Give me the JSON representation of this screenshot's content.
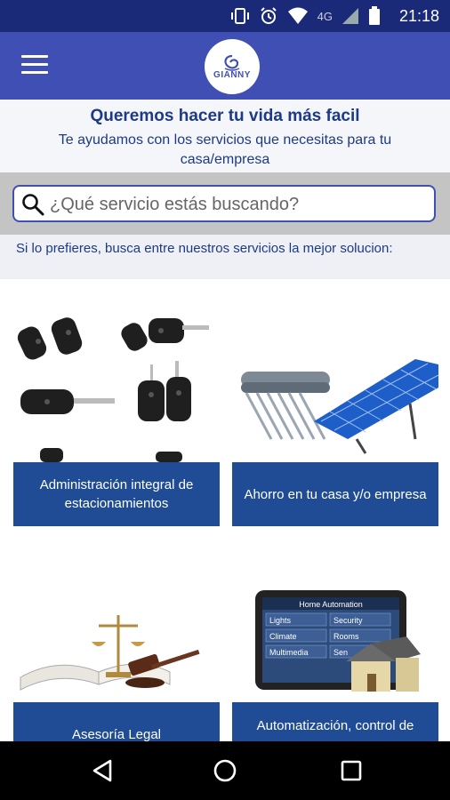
{
  "status": {
    "time": "21:18",
    "network": "4G",
    "icons": [
      "vibrate-icon",
      "alarm-icon",
      "wifi-icon",
      "signal-icon",
      "battery-icon"
    ]
  },
  "appbar": {
    "logo_text": "GIANNY",
    "menu_icon": "hamburger-icon"
  },
  "intro": {
    "title": "Queremos hacer tu vida más facil",
    "subtitle": "Te ayudamos con los servicios que necesitas para tu casa/empresa"
  },
  "search": {
    "placeholder": "¿Qué servicio estás buscando?"
  },
  "hint": "Si lo prefieres, busca entre nuestros servicios la mejor solucion:",
  "services": [
    {
      "label": "Administración integral de estacionamientos",
      "image": "car-keys-image"
    },
    {
      "label": "Ahorro en tu casa y/o empresa",
      "image": "solar-panel-image"
    },
    {
      "label": "Asesoría Legal",
      "image": "legal-gavel-image"
    },
    {
      "label": "Automatización, control de",
      "image": "home-automation-image"
    }
  ],
  "home_automation_screen": {
    "title": "Home Automation",
    "buttons": [
      "Lights",
      "Security",
      "Climate",
      "Rooms",
      "Multimedia",
      "Sen"
    ]
  },
  "colors": {
    "status_bar": "#1a2a78",
    "app_bar": "#3f4fb4",
    "card_label": "#1f4c94",
    "text_accent": "#1d3a86"
  }
}
